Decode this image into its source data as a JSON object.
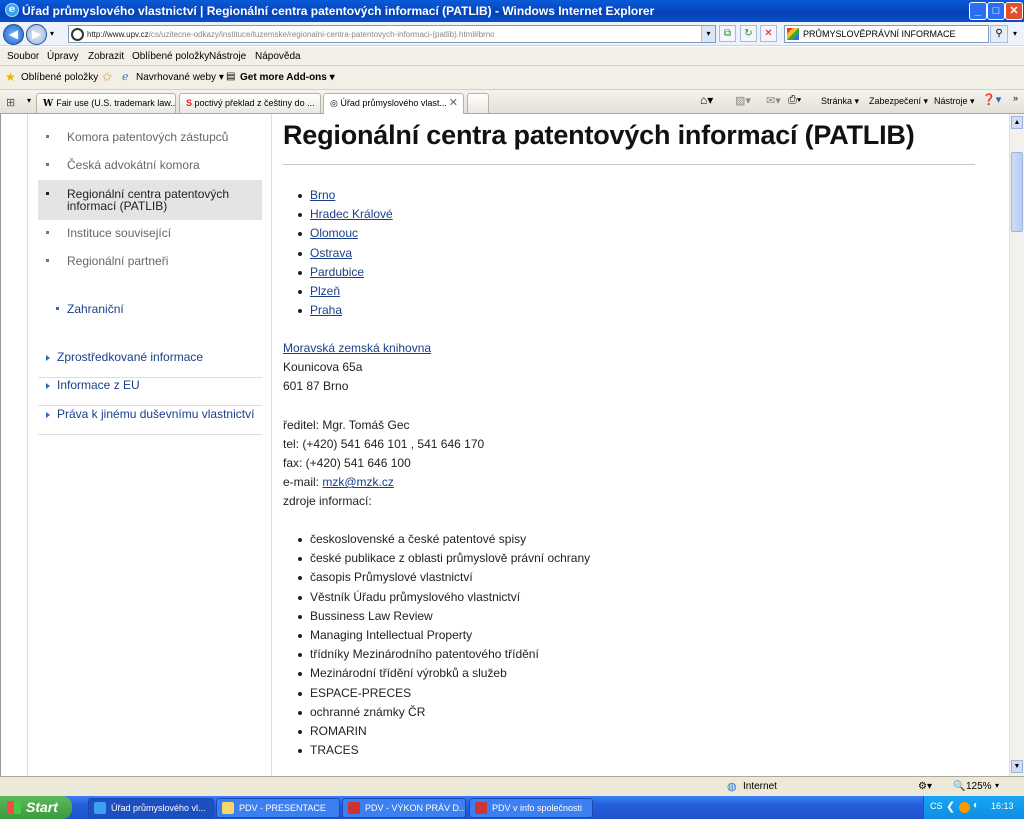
{
  "window": {
    "title": "Úřad průmyslového vlastnictví | Regionální centra patentových informací (PATLIB) - Windows Internet Explorer",
    "minimize": "_",
    "maximize": "□",
    "close": "✕"
  },
  "address": {
    "url_host": "http://www.upv.cz",
    "url_path": "/cs/uzitecne-odkazy/instituce/tuzemske/regionalni-centra-patentovych-informaci-(patlib).html#brno",
    "search_value": "PRŮMYSLOVĚPRÁVNÍ INFORMACE"
  },
  "menu": [
    "Soubor",
    "Úpravy",
    "Zobrazit",
    "Oblíbené položky",
    "Nástroje",
    "Nápověda"
  ],
  "favbar": {
    "favorites": "Oblíbené položky",
    "suggested": "Navrhované weby ▾",
    "addons": "Get more Add-ons ▾"
  },
  "tabs": [
    {
      "label": "Fair use (U.S. trademark law..."
    },
    {
      "label": "poctivý překlad z češtiny do ..."
    },
    {
      "label": "Úřad průmyslového vlast..."
    }
  ],
  "cmdbar": {
    "page": "Stránka ▾",
    "security": "Zabezpečení ▾",
    "tools": "Nástroje ▾"
  },
  "sidebar": {
    "items": [
      {
        "label": "Komora patentových zástupců"
      },
      {
        "label": "Česká advokátní komora"
      },
      {
        "label": "Regionální centra patentových informací (PATLIB)"
      },
      {
        "label": "Instituce související"
      },
      {
        "label": "Regionální partneři"
      }
    ],
    "zahranicni": "Zahraniční",
    "links": [
      {
        "label": "Zprostředkované informace"
      },
      {
        "label": "Informace z EU"
      },
      {
        "label": "Práva k jinému duševnímu vlastnictví"
      }
    ]
  },
  "main": {
    "title": "Regionální centra patentových informací (PATLIB)",
    "cities": [
      "Brno",
      "Hradec Králové",
      "Olomouc",
      "Ostrava",
      "Pardubice",
      "Plzeň",
      "Praha"
    ],
    "library_link": "Moravská zemská knihovna",
    "address1": "Kounicova 65a",
    "address2": "601 87 Brno",
    "director": "ředitel: Mgr. Tomáš Gec",
    "tel": "tel:  (+420) 541 646 101 ,  541 646 170",
    "fax": "fax: (+420) 541 646 100",
    "email_label": "e-mail: ",
    "email": "mzk@mzk.cz",
    "sources_label": "zdroje informací:",
    "sources": [
      "československé a české patentové spisy",
      "české publikace z oblasti průmyslově právní ochrany",
      "časopis Průmyslové vlastnictví",
      "Věstník Úřadu průmyslového vlastnictví",
      "Bussiness Law Review",
      "Managing Intellectual Property",
      "třídníky Mezinárodního patentového třídění",
      "Mezinárodní třídění výrobků a služeb",
      "ESPACE-PRECES",
      "ochranné známky ČR",
      "ROMARIN",
      "TRACES"
    ]
  },
  "status": {
    "zone": "Internet",
    "zoom": "125%"
  },
  "taskbar": {
    "start": "Start",
    "tasks": [
      {
        "label": "Úřad průmyslového vl..."
      },
      {
        "label": "PDV - PRESENTACE"
      },
      {
        "label": "PDV - VÝKON PRÁV D..."
      },
      {
        "label": "PDV v info společnosti"
      }
    ],
    "lang": "CS",
    "clock": "16:13"
  }
}
